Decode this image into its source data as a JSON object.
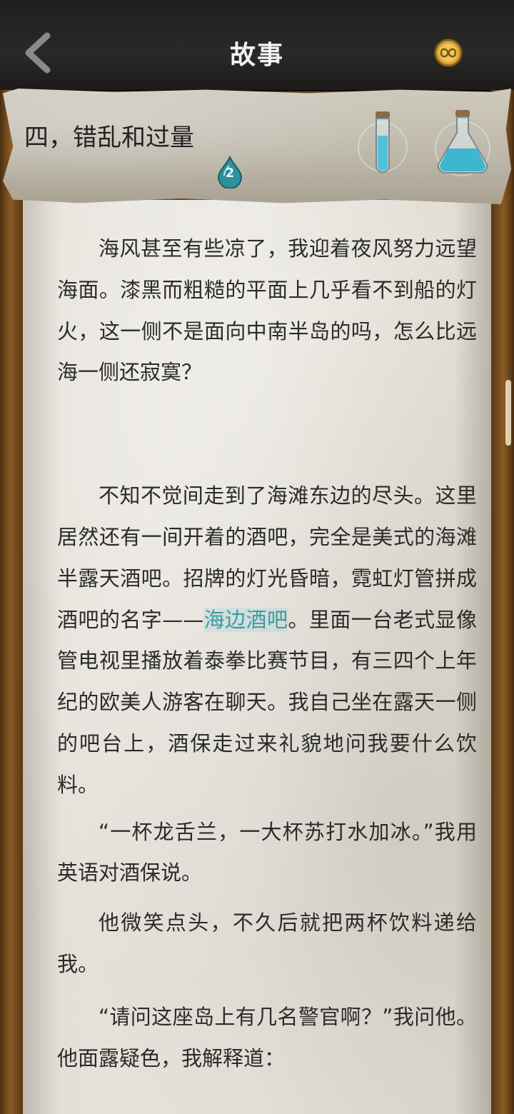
{
  "nav": {
    "title": "故事",
    "back_icon": "chevron-left-icon",
    "currency_icon": "infinity-coin-icon"
  },
  "chapter": {
    "title": "四，错乱和过量",
    "drop_count": "2",
    "items": [
      "test-tube-potion-icon",
      "round-flask-potion-icon"
    ]
  },
  "story": {
    "p1": "海风甚至有些凉了，我迎着夜风努力远望海面。漆黑而粗糙的平面上几乎看不到船的灯火，这一侧不是面向中南半岛的吗，怎么比远海一侧还寂寞？",
    "p2_a": "不知不觉间走到了海滩东边的尽头。这里居然还有一间开着的酒吧，完全是美式的海滩半露天酒吧。招牌的灯光昏暗，霓虹灯管拼成酒吧的名字——",
    "p2_link": "海边酒吧",
    "p2_b": "。里面一台老式显像管电视里播放着泰拳比赛节目，有三四个上年纪的欧美人游客在聊天。我自己坐在露天一侧的吧台上，酒保走过来礼貌地问我要什么饮料。",
    "p3": "“一杯龙舌兰，一大杯苏打水加冰。”我用英语对酒保说。",
    "p4": "他微笑点头，不久后就把两杯饮料递给我。",
    "p5": "“请问这座岛上有几名警官啊？”我问他。他面露疑色，我解释道："
  },
  "colors": {
    "accent_link": "#3e9aa4",
    "paper": "#e7e3db",
    "topbar": "#252423"
  }
}
